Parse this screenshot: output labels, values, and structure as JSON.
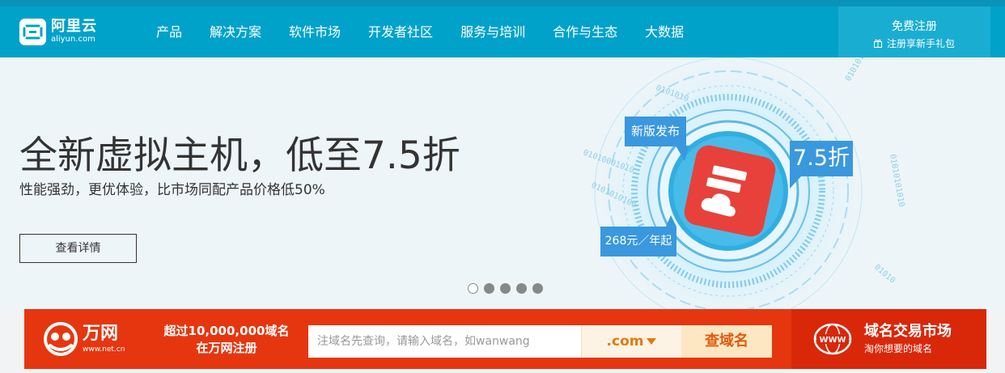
{
  "header": {
    "logo": {
      "name_cn": "阿里云",
      "name_en": "aliyun.com"
    },
    "nav": [
      "产品",
      "解决方案",
      "软件市场",
      "开发者社区",
      "服务与培训",
      "合作与生态",
      "大数据"
    ],
    "register": {
      "title": "免费注册",
      "subtitle": "注册享新手礼包",
      "icon": "gift-icon"
    },
    "colors": {
      "bar": "#00a2ca",
      "register_bg": "#1aadd2"
    }
  },
  "banner": {
    "headline": "全新虚拟主机，低至7.5折",
    "subline": "性能强劲，更优体验，比市场同配产品价格低50%",
    "detail_button": "查看详情",
    "tags": {
      "new": "新版发布",
      "price": "268元／年起",
      "discount": "7.5折"
    },
    "carousel": {
      "count": 5,
      "active": 1
    },
    "colors": {
      "tag": "#3a98de",
      "icon_tile": "#e8413b"
    }
  },
  "domain_bar": {
    "brand": {
      "name": "万网",
      "url": "www.net.cn"
    },
    "promo_line1": "超过10,000,000域名",
    "promo_line2": "在万网注册",
    "search_placeholder": "注域名先查询，请输入域名，如wanwang",
    "tld": ".com",
    "query_button": "查域名",
    "market": {
      "title": "域名交易市场",
      "subtitle": "淘你想要的域名",
      "icon": "www-globe-icon"
    },
    "colors": {
      "bar": "#e6360f",
      "market_bg": "#d9270a",
      "accent": "#e07b0d"
    }
  }
}
